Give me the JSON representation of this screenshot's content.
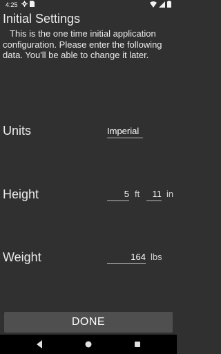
{
  "status": {
    "time": "4:25"
  },
  "header": {
    "title": "Initial Settings",
    "intro": "This is the one time initial application configuration. Please enter the following data. You'll be able to change it later."
  },
  "units": {
    "label": "Units",
    "value": "Imperial"
  },
  "height": {
    "label": "Height",
    "feet": "5",
    "feet_unit": "ft",
    "inches": "11",
    "inches_unit": "in"
  },
  "weight": {
    "label": "Weight",
    "value": "164",
    "unit": "lbs"
  },
  "actions": {
    "done_label": "DONE"
  },
  "icons": {
    "status_left": [
      "settings-gear-icon",
      "sim-card-icon"
    ],
    "status_right": [
      "wifi-icon",
      "signal-icon",
      "battery-icon"
    ],
    "nav": [
      "back-icon",
      "home-icon",
      "recents-icon"
    ]
  }
}
